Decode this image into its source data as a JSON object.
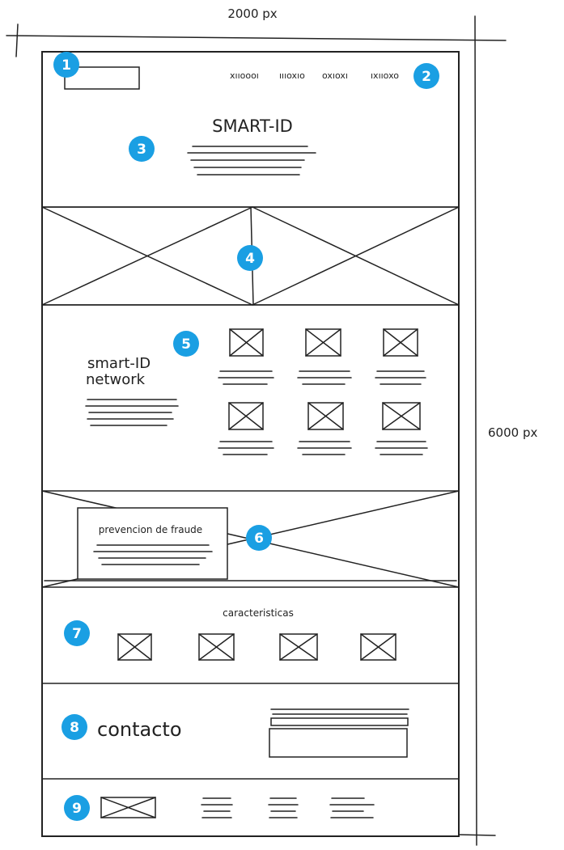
{
  "dimensions": {
    "width_label": "2000 px",
    "height_label": "6000 px"
  },
  "header": {
    "logo_label": "1",
    "nav_items": [
      "xııoooı",
      "ıııoxıo",
      "oxıoxı",
      "ıxııoxo"
    ]
  },
  "hero": {
    "title": "SMART-ID"
  },
  "network": {
    "title_line1": "smart-ID",
    "title_line2": "network"
  },
  "fraud": {
    "title": "prevencion de fraude"
  },
  "features": {
    "title": "caracteristicas"
  },
  "contact": {
    "title": "contacto"
  },
  "badges": [
    "1",
    "2",
    "3",
    "4",
    "5",
    "6",
    "7",
    "8",
    "9"
  ],
  "colors": {
    "badge": "#1a9fe3",
    "ink": "#222222"
  }
}
